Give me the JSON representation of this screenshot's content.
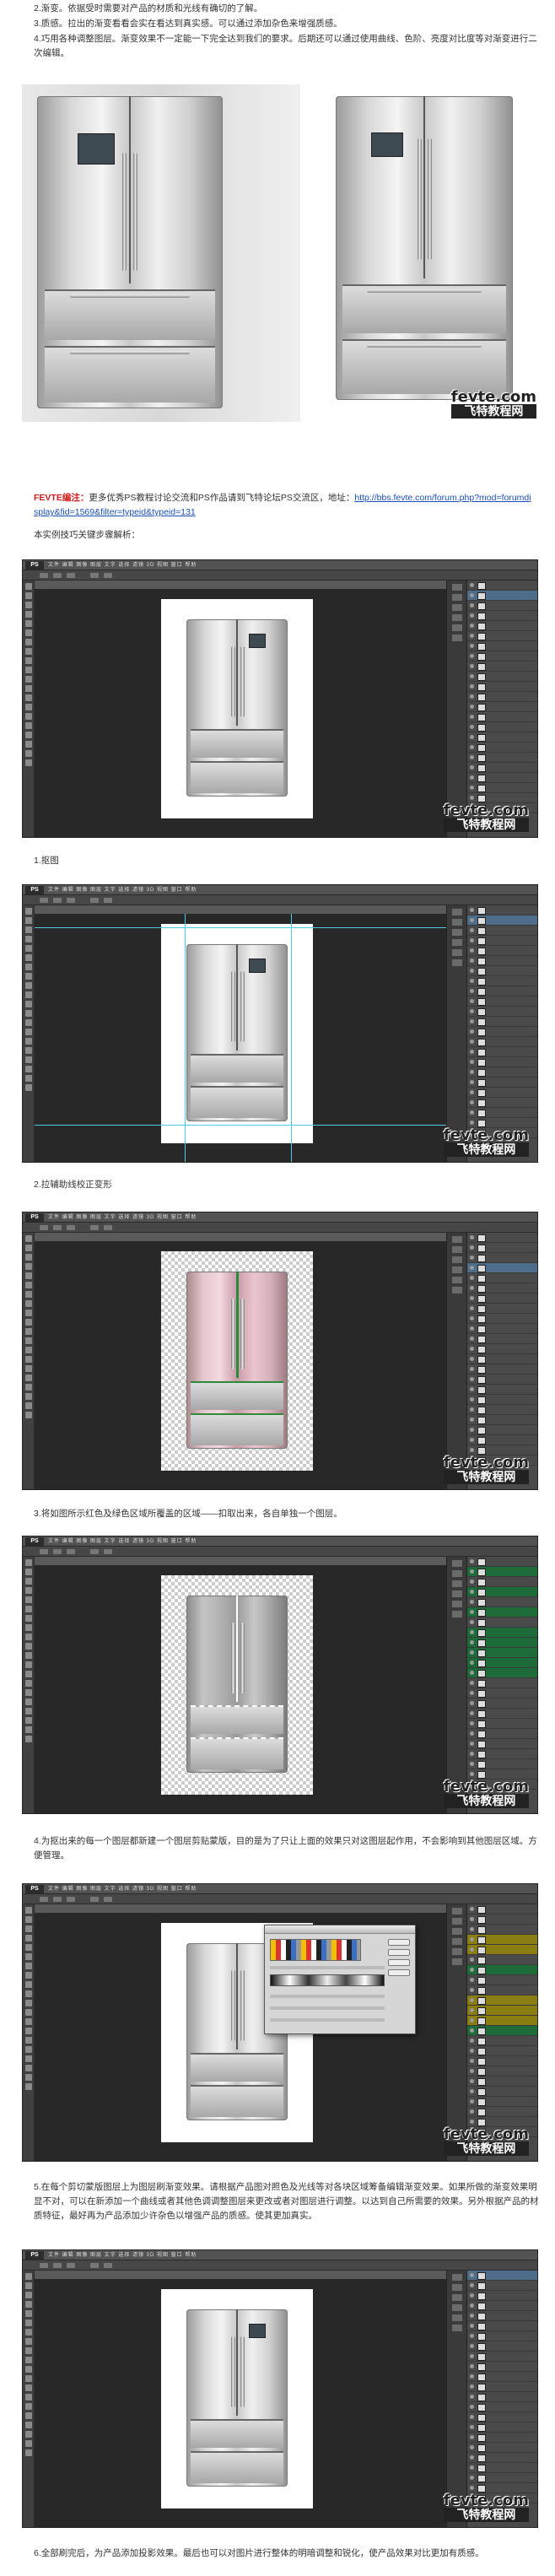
{
  "intro": {
    "line2": "2.渐变。依据受时需要对产品的材质和光线有确切的了解。",
    "line3": "3.质感。拉出的渐变看看会实在看达到真实感。可以通过添加杂色来增强质感。",
    "line4": "4.巧用各种调整图层。渐变效果不一定能一下完全达到我们的要求。后期还可以通过使用曲线、色阶、亮度对比度等对渐变进行二次编辑。"
  },
  "watermark": {
    "domain": "fevte.com",
    "brand": "飞特教程网"
  },
  "editor_note": {
    "prefix": "FEVTE编注：",
    "text": "更多优秀PS教程讨论交流和PS作品请到飞特论坛PS交流区，地址：",
    "url": "http://bbs.fevte.com/forum.php?mod=forumdisplay&fid=1569&filter=typeid&typeid=131"
  },
  "steps_intro": "本实例技巧关键步骤解析：",
  "steps": [
    {
      "caption": "1.抠图"
    },
    {
      "caption": "2.拉辅助线校正变形"
    },
    {
      "caption": "3.将如图所示红色及绿色区域所覆盖的区域——扣取出来，各自单独一个图层。"
    },
    {
      "caption": "4.为抠出来的每一个图层都新建一个图层剪贴蒙版，目的是为了只让上面的效果只对这图层起作用，不会影响到其他图层区域。方便管理。"
    },
    {
      "caption": "5.在每个剪切蒙版图层上为图层刷渐变效果。请根据产品图对照色及光线等对各块区域筹备编辑渐变效果。如果所做的渐变效果明显不对，可以在新添加一个曲线或者其他色调调整图层来更改或者对图层进行调整。以达到自己所需要的效果。另外根据产品的材质特征，最好再为产品添加少许杂色以增强产品的质感。使其更加真实。"
    },
    {
      "caption": "6.全部刷完后，为产品添加投影效果。最后也可以对图片进行整体的明暗调整和锐化，使产品效果对比更加有质感。"
    }
  ],
  "ps": {
    "logo": "PS",
    "menus": "文件 编辑 图像 图层 文字 选择 滤镜 3D 视图 窗口 帮助"
  }
}
